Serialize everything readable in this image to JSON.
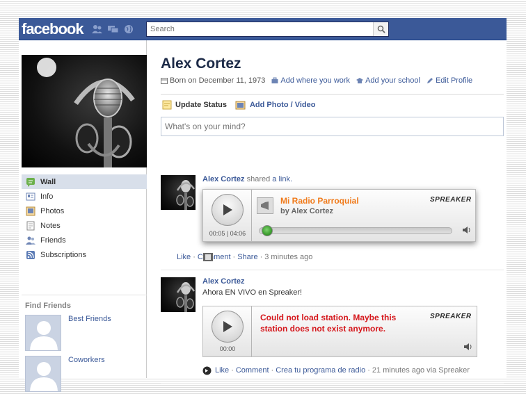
{
  "topbar": {
    "logo": "facebook",
    "search": {
      "placeholder": "Search",
      "value": "Search"
    }
  },
  "profile": {
    "name": "Alex Cortez",
    "born": "Born on December 11, 1973",
    "add_work": "Add where you work",
    "add_school": "Add your school",
    "edit_profile": "Edit Profile"
  },
  "sidebar": {
    "items": [
      {
        "label": "Wall",
        "icon": "wall-icon",
        "active": true
      },
      {
        "label": "Info",
        "icon": "info-icon"
      },
      {
        "label": "Photos",
        "icon": "photos-icon"
      },
      {
        "label": "Notes",
        "icon": "notes-icon"
      },
      {
        "label": "Friends",
        "icon": "friends-icon"
      },
      {
        "label": "Subscriptions",
        "icon": "subscriptions-icon"
      }
    ],
    "find_friends_title": "Find Friends",
    "friend_lists": [
      "Best Friends",
      "Coworkers"
    ]
  },
  "composer": {
    "update_status": "Update Status",
    "add_photo": "Add Photo / Video",
    "placeholder": "What's on your mind?"
  },
  "posts": [
    {
      "author": "Alex Cortez",
      "verb": "shared",
      "link_text": "a link.",
      "player": {
        "brand": "SPREAKER",
        "title": "Mi Radio Parroquial",
        "by": "by Alex Cortez",
        "time": "00:05 | 04:06",
        "progress": 0.03
      },
      "actions": {
        "like": "Like",
        "comment": "Comment",
        "share": "Share",
        "time": "3 minutes ago"
      }
    },
    {
      "author": "Alex Cortez",
      "message": "Ahora EN VIVO en Spreaker!",
      "player": {
        "brand": "SPREAKER",
        "error": "Could not load station. Maybe this station does not exist anymore.",
        "time": "00:00"
      },
      "actions": {
        "like": "Like",
        "comment": "Comment",
        "extra": "Crea tu programa de radio",
        "time": "21 minutes ago via Spreaker"
      }
    }
  ],
  "colors": {
    "brand_blue": "#3b5998",
    "orange": "#f07a1a",
    "error_red": "#d5161b",
    "progress_green": "#3c9d2f"
  }
}
